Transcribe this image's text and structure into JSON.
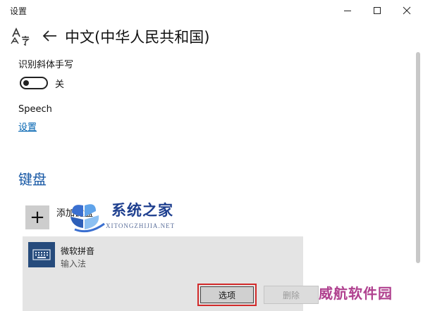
{
  "window": {
    "title": "设置"
  },
  "header": {
    "title": "中文(中华人民共和国)"
  },
  "handwriting": {
    "label": "识别斜体手写",
    "toggle_on": false,
    "toggle_state_label": "关"
  },
  "speech": {
    "title": "Speech",
    "link_label": "设置"
  },
  "keyboard": {
    "heading": "键盘",
    "add_label": "添加键盘",
    "add_glyph": "+",
    "items": [
      {
        "name": "微软拼音",
        "subtitle": "输入法",
        "options_label": "选项",
        "delete_label": "删除"
      }
    ]
  },
  "watermarks": {
    "center_cn": "系统之家",
    "center_en": "XITONGZHIJIA.NET",
    "corner": "威航软件园"
  },
  "colors": {
    "accent": "#0063b1",
    "heading": "#1a5aa6",
    "highlight": "#d22a2a",
    "ime_icon_bg": "#264b7c"
  }
}
